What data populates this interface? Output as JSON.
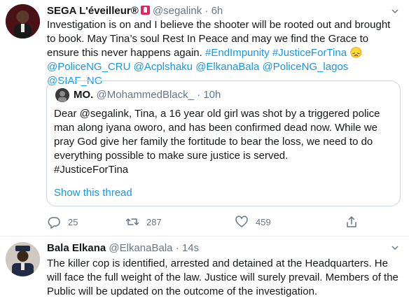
{
  "tweet1": {
    "display_name": "SEGA L'éveilleur®",
    "handle": "@segalink",
    "separator": "·",
    "time": "6h",
    "text_plain": "Investigation is on and I believe the shooter will be rooted out and brought to book. May Tina’s soul Rest In Peace and may we find the Grace to ensure this never happens again. ",
    "hashtags": [
      "#EndImpunity",
      "#JusticeForTina"
    ],
    "emoji": "😞",
    "mentions": [
      "@PoliceNG_CRU",
      "@Acplshaku",
      "@ElkanaBala",
      "@PoliceNG_lagos",
      "@SIAF_NG"
    ],
    "quote": {
      "display_name": "MO.",
      "handle": "@MohammedBlack_",
      "separator": "·",
      "time": "10h",
      "text": "Dear @segalink, Tina, a 16 year old girl was shot by a triggered police man along iyana oworo, and has been confirmed dead now. While we pray God give her family the fortitude to bear the loss, we need to do everything possible to make sure justice is served.",
      "hashtag": "#JusticeForTina",
      "show_thread": "Show this thread"
    },
    "actions": {
      "reply_count": "25",
      "retweet_count": "287",
      "like_count": "459"
    }
  },
  "tweet2": {
    "display_name": "Bala Elkana",
    "handle": "@ElkanaBala",
    "separator": "·",
    "time": "14s",
    "text": "The killer cop is identified, arrested and detained at the Headquarters. He will face the full weight of the law. Justice will surely prevail. Members of the Public will be updated on the outcome of the investigation."
  },
  "colors": {
    "link": "#1b95e0",
    "text": "#14171a",
    "muted": "#657786",
    "border": "#ccd6dd"
  }
}
